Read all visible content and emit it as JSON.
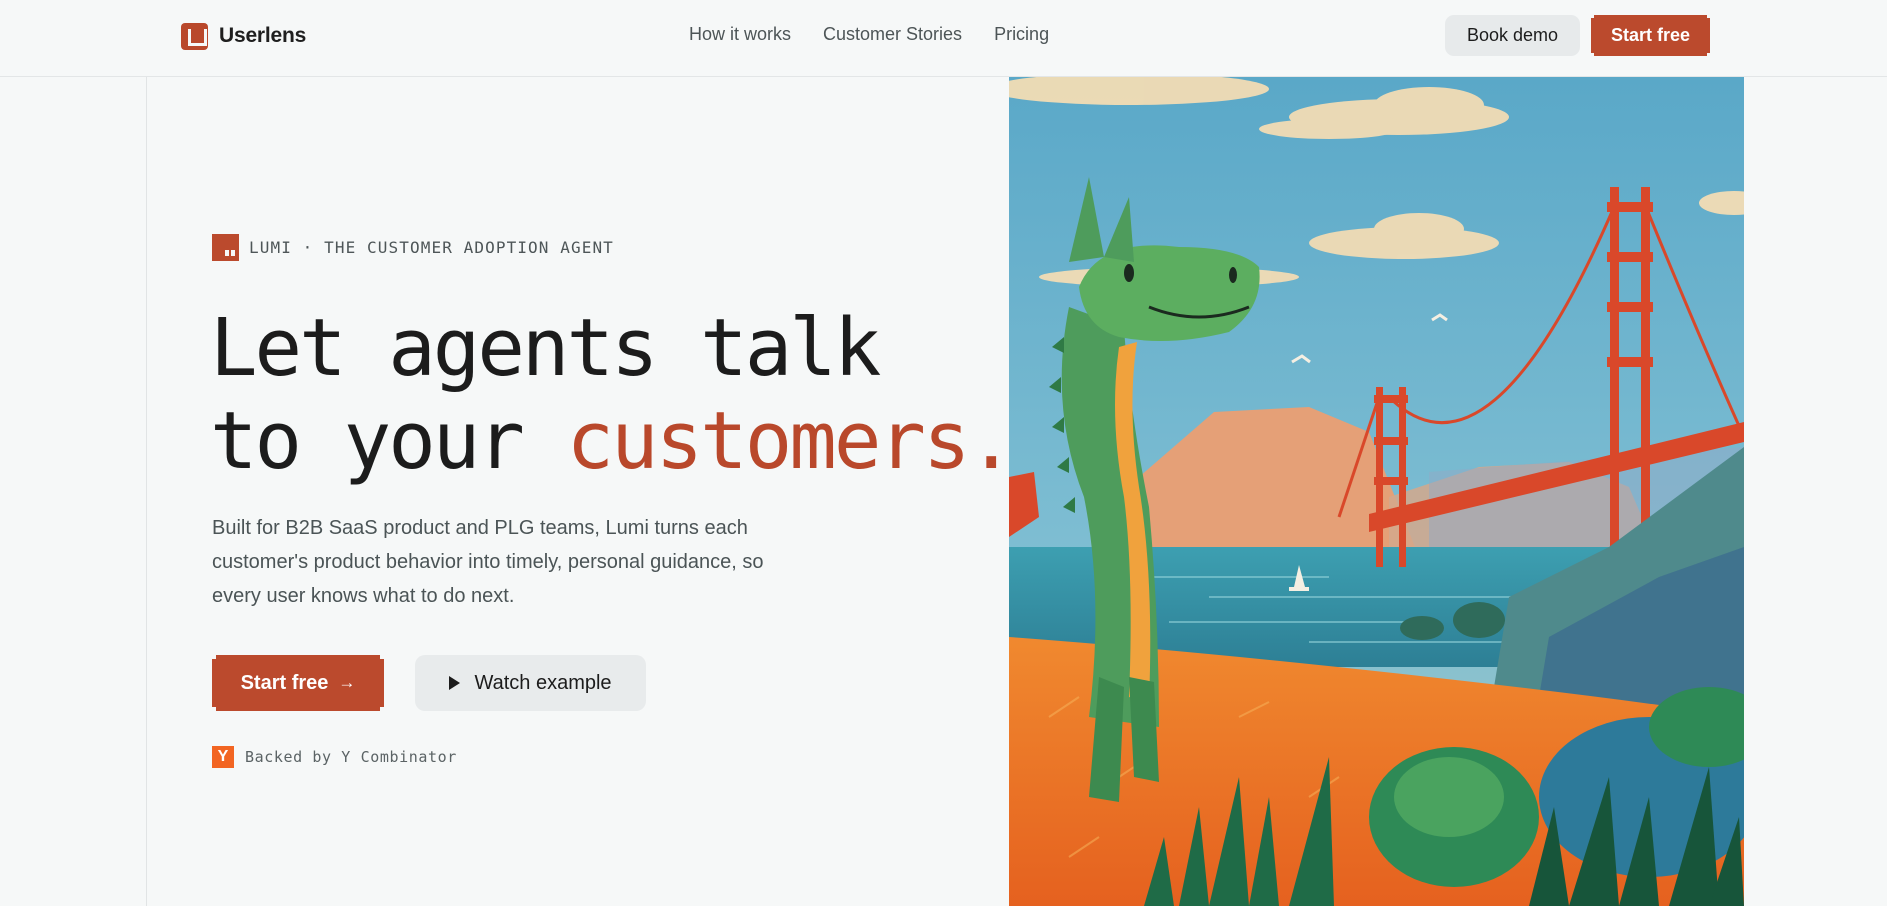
{
  "header": {
    "brand_name": "Userlens",
    "brand_icon": "userlens-logo-icon",
    "nav": [
      {
        "label": "How it works"
      },
      {
        "label": "Customer Stories"
      },
      {
        "label": "Pricing"
      }
    ],
    "book_demo_label": "Book demo",
    "start_free_label": "Start free"
  },
  "hero": {
    "eyebrow_icon": "lumi-icon",
    "eyebrow": "LUMI · THE CUSTOMER ADOPTION AGENT",
    "headline_line1": "Let agents talk",
    "headline_line2_prefix": "to your ",
    "headline_accent": "customers.",
    "description": "Built for B2B SaaS product and PLG teams, Lumi turns each customer's product behavior into timely, personal guidance, so every user knows what to do next.",
    "primary_cta": "Start free",
    "primary_cta_icon": "arrow-right-icon",
    "secondary_cta": "Watch example",
    "secondary_cta_icon": "play-icon",
    "backer_icon_letter": "Y",
    "backer_text": "Backed by Y Combinator"
  },
  "illustration": {
    "subject": "pixel-art dragon beside the Golden Gate Bridge"
  },
  "colors": {
    "accent": "#bb4a2d",
    "background": "#f6f8f8",
    "text": "#1c1c1c",
    "muted_text": "#4b5456",
    "secondary_button": "#e8ebec",
    "yc_orange": "#f26522"
  }
}
